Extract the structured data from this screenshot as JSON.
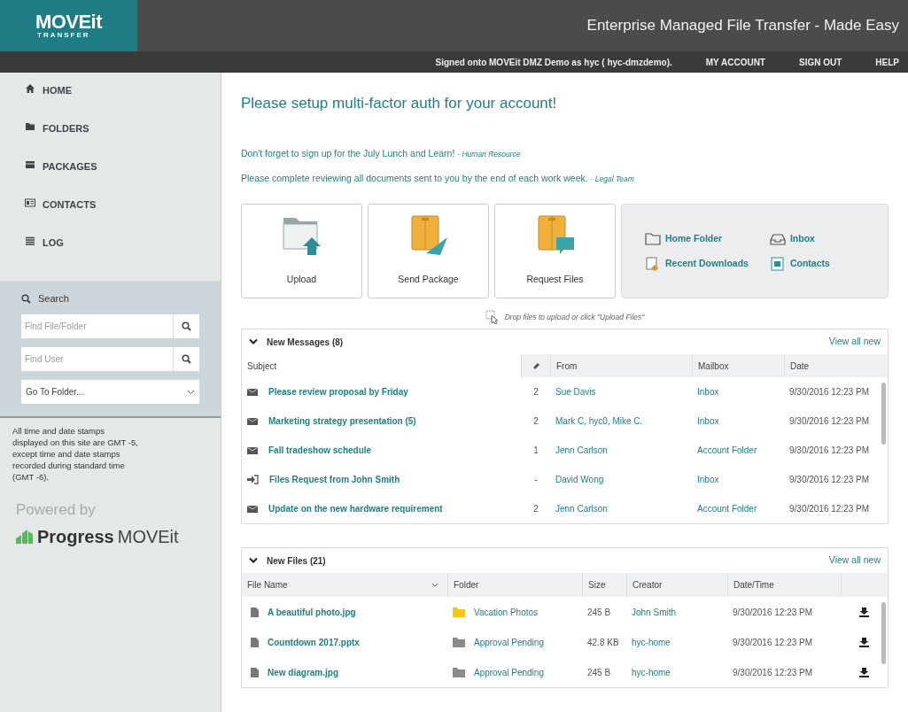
{
  "header": {
    "logo_title": "MOVEit",
    "logo_subtitle": "TRANSFER",
    "tagline": "Enterprise Managed File Transfer - Made Easy",
    "signed_in": "Signed onto **MOVEit DMZ Demo** as **hyc** ( hyc-dmzdemo).",
    "links": [
      "MY ACCOUNT",
      "SIGN OUT",
      "HELP"
    ]
  },
  "sidebar": {
    "items": [
      {
        "label": "HOME",
        "kind": "home"
      },
      {
        "label": "FOLDERS",
        "kind": "folder"
      },
      {
        "label": "PACKAGES",
        "kind": "package"
      },
      {
        "label": "CONTACTS",
        "kind": "contact"
      },
      {
        "label": "LOG",
        "kind": "log"
      }
    ],
    "search": {
      "title": "Search",
      "file_placeholder": "Find File/Folder",
      "user_placeholder": "Find User",
      "folder_select": "Go To Folder..."
    },
    "note": "All time and date stamps displayed on this site are GMT -5, except time and date stamps recorded during standard time (GMT -6).",
    "powered_by": "Powered by",
    "brand": "Progress",
    "brand_product": "MOVEit"
  },
  "main": {
    "alert": "Please setup multi-factor auth for your account!",
    "notices": [
      {
        "text": "Don't forget to sign up for the July Lunch and Learn!",
        "source": "- Human Resource"
      },
      {
        "text": "Please complete reviewing all documents sent to you by the end of each work week.",
        "source": "- Legal Team"
      }
    ],
    "actions": [
      {
        "label": "Upload",
        "kind": "upload"
      },
      {
        "label": "Send Package",
        "kind": "send"
      },
      {
        "label": "Request Files",
        "kind": "request"
      }
    ],
    "shortcuts": [
      {
        "label": "Home Folder",
        "kind": "folder"
      },
      {
        "label": "Inbox",
        "kind": "inbox"
      },
      {
        "label": "Recent Downloads",
        "kind": "downloads"
      },
      {
        "label": "Contacts",
        "kind": "contacts"
      }
    ],
    "drop_hint": "Drop files to upload or click \"Upload Files\"",
    "messages": {
      "title": "New Messages (8)",
      "view_all": "View all new",
      "columns": [
        "Subject",
        "From",
        "Mailbox",
        "Date"
      ],
      "rows": [
        {
          "kind": "message",
          "subject": "Please review proposal by Friday",
          "attachments": "2",
          "from": "Sue Davis",
          "mailbox": "Inbox",
          "date": "9/30/2016 12:23 PM"
        },
        {
          "kind": "message",
          "subject": "Marketing strategy presentation (5)",
          "attachments": "2",
          "from": "Mark C, hyc0, Mike C.",
          "mailbox": "Inbox",
          "date": "9/30/2016 12:23 PM"
        },
        {
          "kind": "message",
          "subject": "Fall tradeshow schedule",
          "attachments": "1",
          "from": "Jenn Carlson",
          "mailbox": "Account Folder",
          "date": "9/30/2016 12:23 PM"
        },
        {
          "kind": "request",
          "subject": "Files Request from John Smith",
          "attachments": "-",
          "from": "David Wong",
          "mailbox": "Inbox",
          "date": "9/30/2016 12:23 PM"
        },
        {
          "kind": "message",
          "subject": "Update on the new hardware requirement",
          "attachments": "2",
          "from": "Jenn Carlson",
          "mailbox": "Account Folder",
          "date": "9/30/2016 12:23 PM"
        }
      ]
    },
    "files": {
      "title": "New Files (21)",
      "view_all": "View all new",
      "columns": [
        "File Name",
        "Folder",
        "Size",
        "Creator",
        "Date/Time"
      ],
      "rows": [
        {
          "name": "A beautiful photo.jpg",
          "folder": "Vacation Photos",
          "color": "#f5c518",
          "size": "245 B",
          "creator": "John Smith",
          "date": "9/30/2016 12:23 PM"
        },
        {
          "name": "Countdown 2017.pptx",
          "folder": "Approval Pending",
          "color": "#8a8a8a",
          "size": "42.8 KB",
          "creator": "hyc-home",
          "date": "9/30/2016 12:23 PM"
        },
        {
          "name": "New diagram.jpg",
          "folder": "Approval Pending",
          "color": "#8a8a8a",
          "size": "245 B",
          "creator": "hyc-home",
          "date": "9/30/2016 12:23 PM"
        }
      ]
    }
  }
}
